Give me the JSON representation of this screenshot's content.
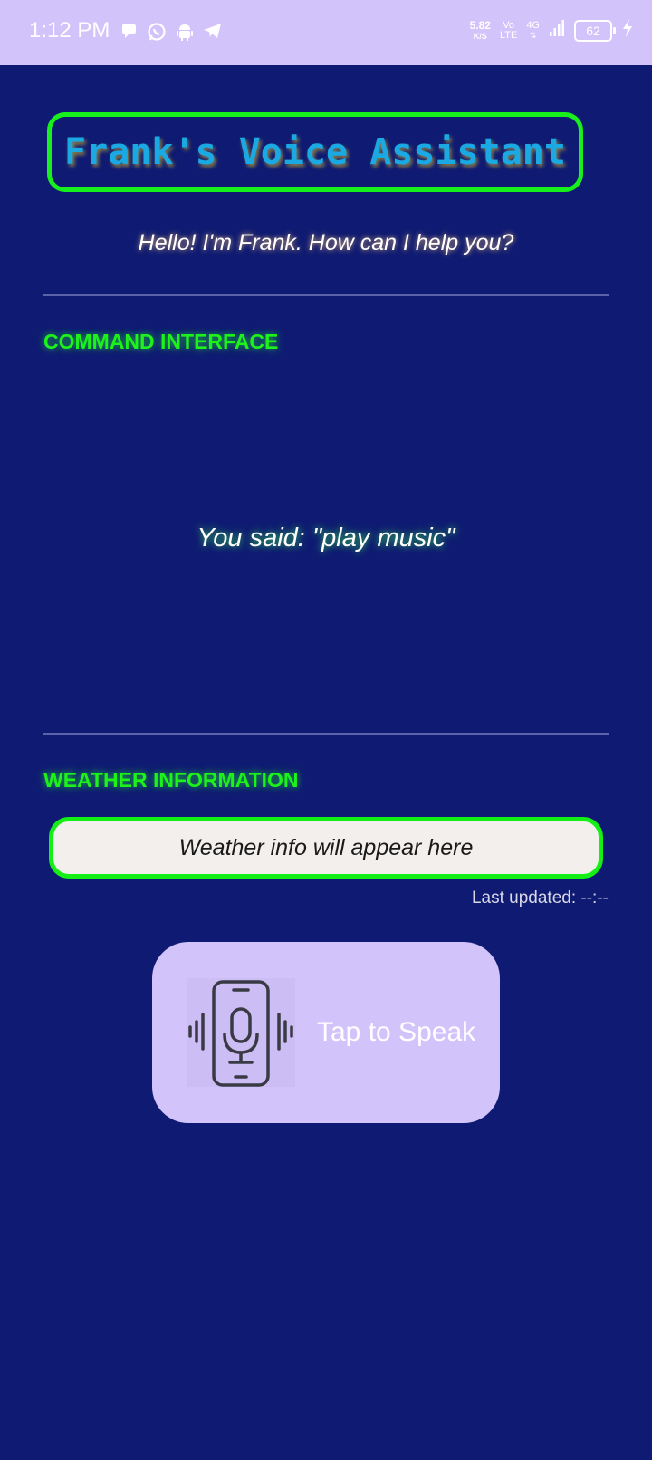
{
  "status_bar": {
    "time": "1:12 PM",
    "net_speed_value": "5.82",
    "net_speed_unit": "K/S",
    "volte_top": "Vo",
    "volte_bottom": "LTE",
    "network_type": "4G",
    "battery_level": "62",
    "icons": [
      "chat-bubble-icon",
      "whatsapp-icon",
      "android-icon",
      "telegram-icon",
      "signal-icon",
      "battery-icon",
      "charging-icon"
    ]
  },
  "header": {
    "title": "Frank's Voice Assistant",
    "greeting": "Hello! I'm Frank. How can I help you?"
  },
  "command_section": {
    "heading": "COMMAND INTERFACE",
    "recognized_text": "You said: \"play music\""
  },
  "weather_section": {
    "heading": "WEATHER INFORMATION",
    "placeholder": "Weather info will appear here",
    "last_updated": "Last updated: --:--"
  },
  "speak_button": {
    "label": "Tap to Speak",
    "icon": "phone-microphone-icon"
  },
  "colors": {
    "background": "#0f1b72",
    "status_bar": "#d3c3fb",
    "accent_green": "#17f01c",
    "title_blue": "#1aa9e3",
    "button_bg": "#d3c3fb"
  }
}
